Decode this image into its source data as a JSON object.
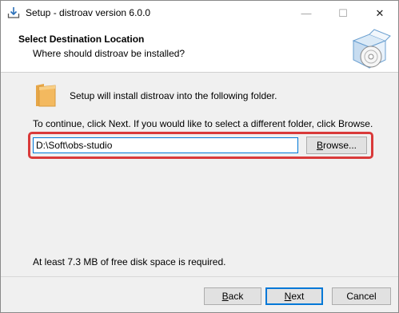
{
  "window": {
    "title": "Setup - distroav version 6.0.0",
    "minimize_glyph": "—",
    "maximize_glyph": "☐",
    "close_glyph": "✕"
  },
  "header": {
    "title": "Select Destination Location",
    "subtitle": "Where should distroav be installed?",
    "icon": "setup-box-disc-icon"
  },
  "body": {
    "install_message": "Setup will install distroav into the following folder.",
    "continue_message": "To continue, click Next. If you would like to select a different folder, click Browse.",
    "path_value": "D:\\Soft\\obs-studio",
    "browse": {
      "accel": "B",
      "rest": "rowse..."
    },
    "disk_space_message": "At least 7.3 MB of free disk space is required."
  },
  "buttons": {
    "back": {
      "accel": "B",
      "rest": "ack"
    },
    "next": {
      "accel": "N",
      "rest": "ext"
    },
    "cancel": "Cancel"
  },
  "colors": {
    "highlight": "#d93a3a",
    "focus": "#0078d7",
    "folder": "#f3b95f"
  }
}
